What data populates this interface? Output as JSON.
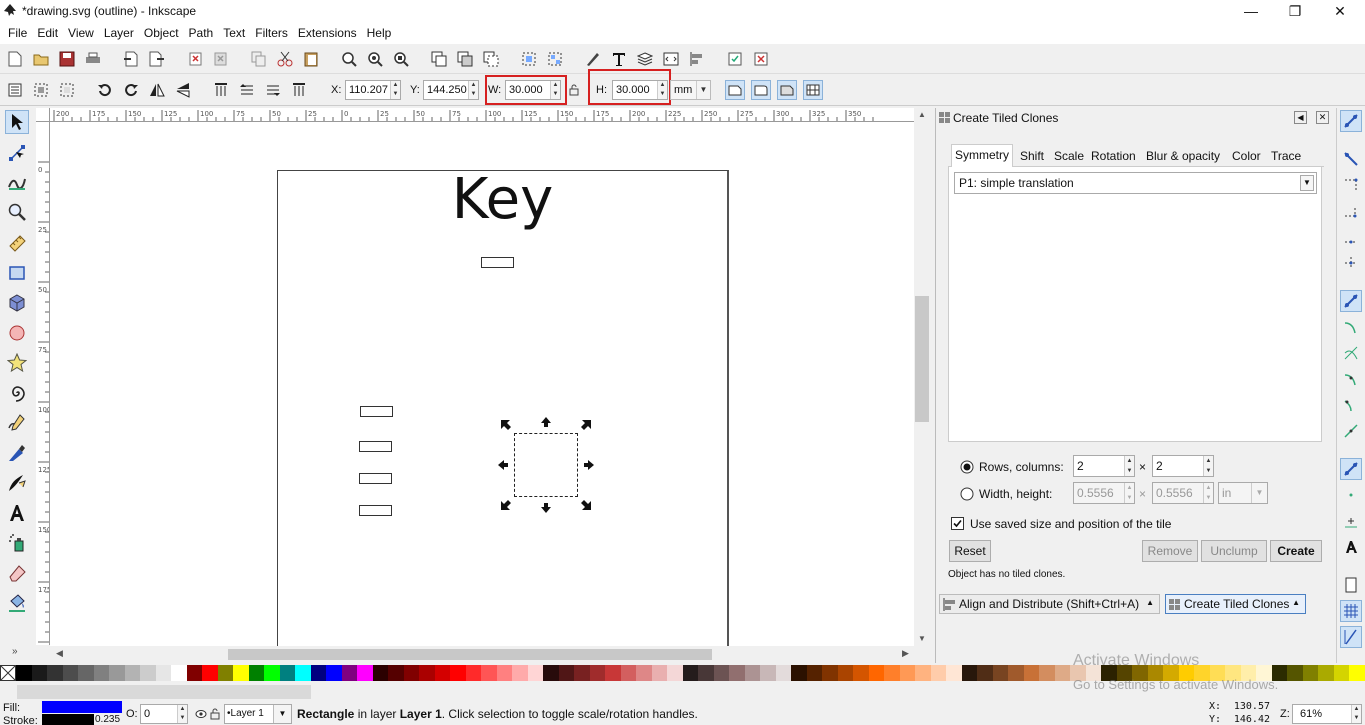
{
  "window": {
    "title": "*drawing.svg (outline) - Inkscape",
    "minimize": "—",
    "maximize": "❐",
    "close": "✕"
  },
  "menu": [
    "File",
    "Edit",
    "View",
    "Layer",
    "Object",
    "Path",
    "Text",
    "Filters",
    "Extensions",
    "Help"
  ],
  "controls": {
    "x_label": "X:",
    "x_value": "110.207",
    "y_label": "Y:",
    "y_value": "144.250",
    "w_label": "W:",
    "w_value": "30.000",
    "h_label": "H:",
    "h_value": "30.000",
    "unit": "mm"
  },
  "canvas": {
    "page_text": "Key"
  },
  "ruler": {
    "h_ticks": [
      "200",
      "175",
      "150",
      "125",
      "100",
      "75",
      "50",
      "25",
      "0",
      "25",
      "50",
      "75",
      "100",
      "125",
      "150",
      "175",
      "200",
      "225",
      "250",
      "275",
      "300",
      "325",
      "350"
    ],
    "v_ticks": [
      "0",
      "25",
      "50",
      "75",
      "100",
      "125",
      "150",
      "175",
      "200"
    ]
  },
  "dialog": {
    "title": "Create Tiled Clones",
    "tabs": [
      "Symmetry",
      "Shift",
      "Scale",
      "Rotation",
      "Blur & opacity",
      "Color",
      "Trace"
    ],
    "symmetry_value": "P1: simple translation",
    "rows_columns_label": "Rows, columns:",
    "rows": "2",
    "cols": "2",
    "times": "×",
    "width_height_label": "Width, height:",
    "width": "0.5556",
    "height": "0.5556",
    "wh_unit": "in",
    "use_saved_label": "Use saved size and position of the tile",
    "reset": "Reset",
    "remove": "Remove",
    "unclump": "Unclump",
    "create": "Create",
    "status": "Object has no tiled clones.",
    "dock_tab1": "Align and Distribute (Shift+Ctrl+A)",
    "dock_tab2": "Create Tiled Clones"
  },
  "status": {
    "fill_label": "Fill:",
    "stroke_label": "Stroke:",
    "stroke_width": "0.235",
    "opacity_label": "O:",
    "opacity_value": "0",
    "layer": "•Layer 1",
    "message_bold": "Rectangle",
    "message_mid": " in layer ",
    "message_layer": "Layer 1",
    "message_tail": ". Click selection to toggle scale/rotation handles.",
    "coord_x_label": "X:",
    "coord_x": "130.57",
    "coord_y_label": "Y:",
    "coord_y": "146.42",
    "zoom_label": "Z:",
    "zoom": "61%"
  },
  "watermark": {
    "line1": "Activate Windows",
    "line2": "Go to Settings to activate Windows."
  },
  "colors": {
    "accent_red": "#d62020",
    "fill_swatch": "#0000ff",
    "stroke_swatch": "#000000"
  }
}
